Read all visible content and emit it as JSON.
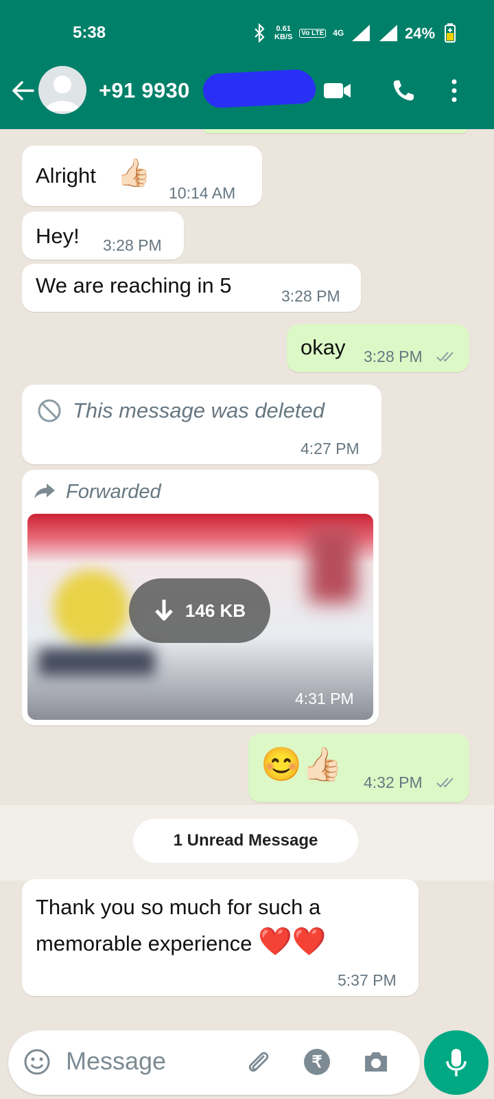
{
  "status_bar": {
    "time": "5:38",
    "network_speed": "0.61",
    "network_unit": "KB/S",
    "volte": "Vo LTE",
    "network_type": "4G",
    "battery": "24%"
  },
  "header": {
    "contact": "+91 9930"
  },
  "messages": [
    {
      "text": "Alright",
      "time": "10:14 AM",
      "emoji": "👍🏻"
    },
    {
      "text": "Hey!",
      "time": "3:28 PM"
    },
    {
      "text": "We are reaching in 5",
      "time": "3:28 PM"
    },
    {
      "text": "okay",
      "time": "3:28 PM"
    },
    {
      "text": "This message was deleted",
      "time": "4:27 PM"
    },
    {
      "label": "Forwarded",
      "size": "146 KB",
      "time": "4:31 PM"
    },
    {
      "emoji": "😊👍🏻",
      "time": "4:32 PM"
    },
    {
      "text": "Thank you so much for such a memorable experience",
      "emoji": "❤️❤️",
      "time": "5:37 PM"
    }
  ],
  "divider": {
    "label": "1 Unread Message"
  },
  "input": {
    "placeholder": "Message"
  },
  "colors": {
    "header": "#008069",
    "outgoing": "#dcf8c6",
    "accent": "#00a884"
  }
}
